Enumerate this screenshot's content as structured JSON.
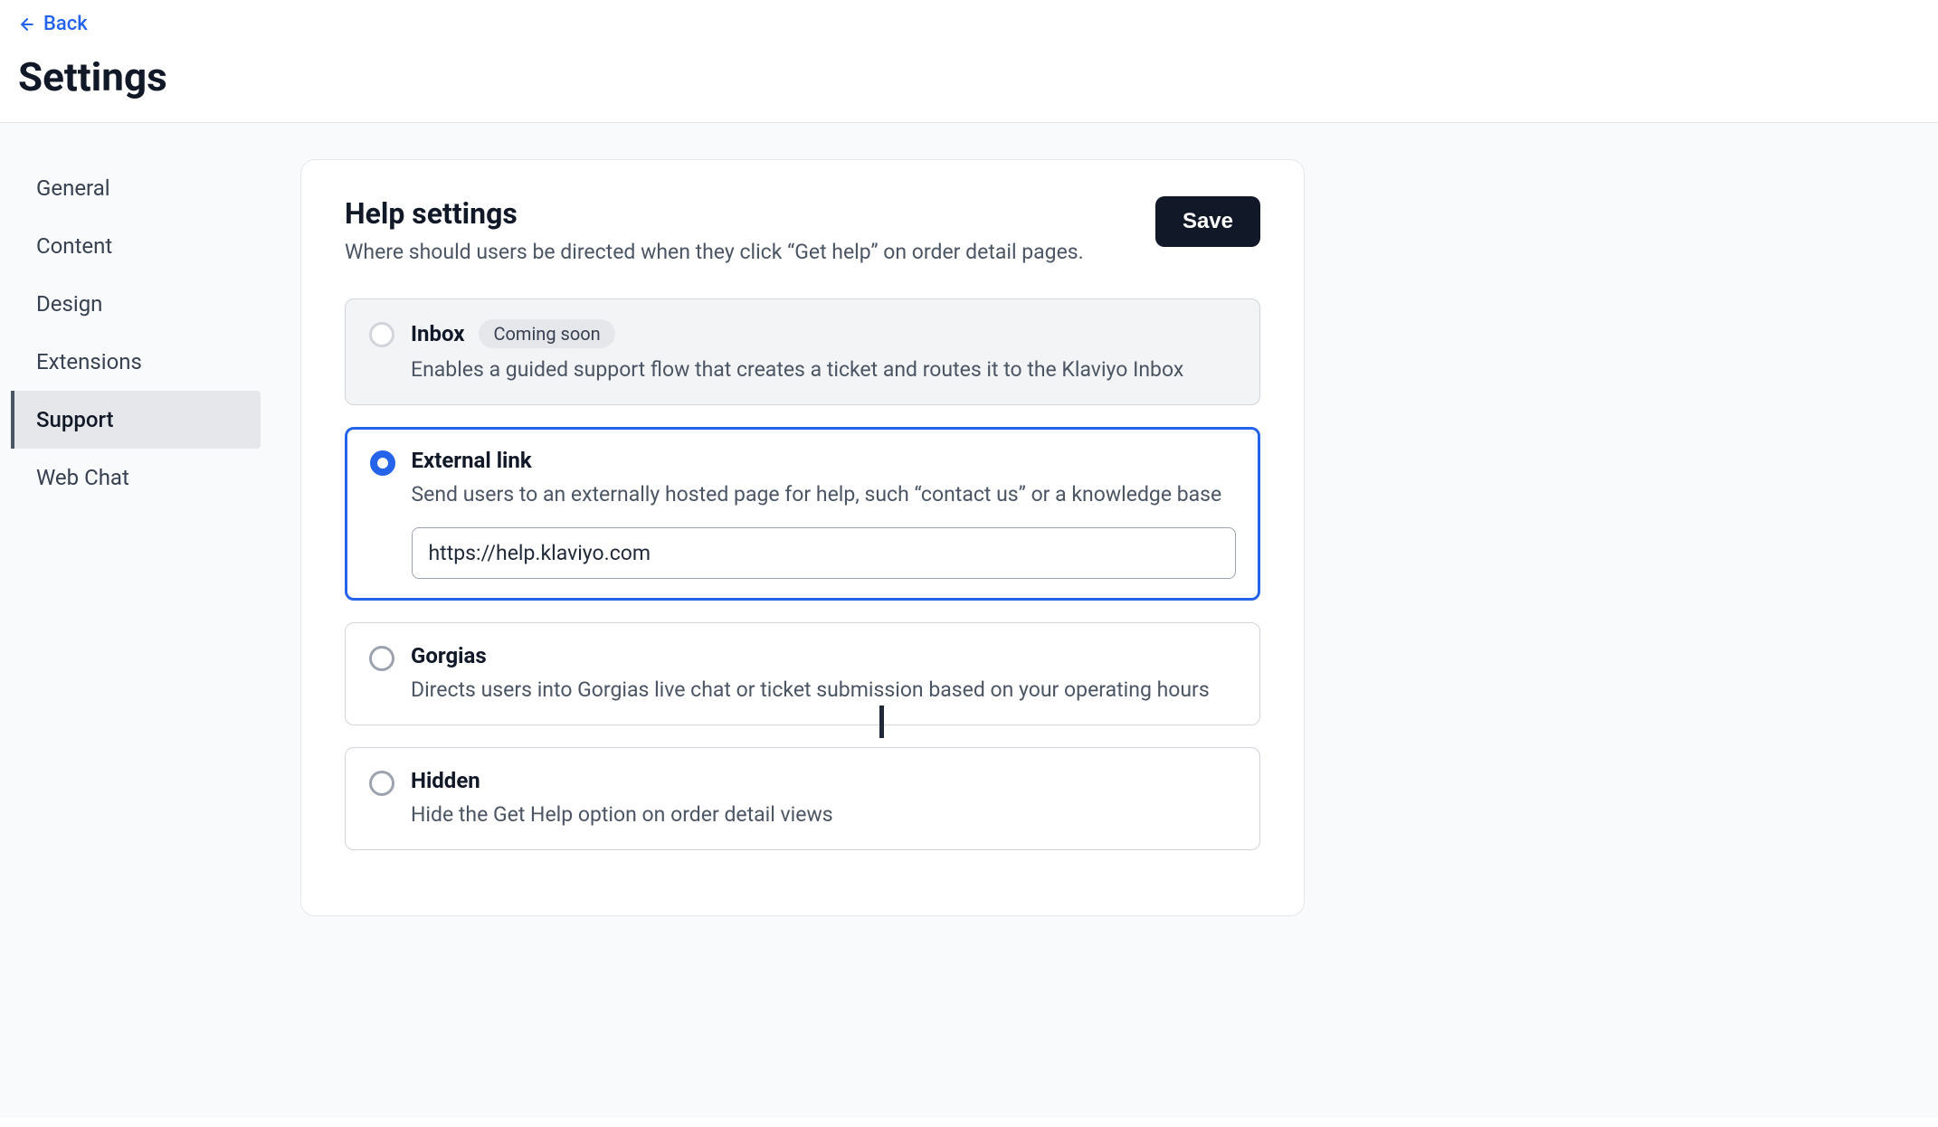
{
  "header": {
    "back_label": "Back",
    "title": "Settings"
  },
  "sidebar": {
    "items": [
      {
        "label": "General",
        "active": false
      },
      {
        "label": "Content",
        "active": false
      },
      {
        "label": "Design",
        "active": false
      },
      {
        "label": "Extensions",
        "active": false
      },
      {
        "label": "Support",
        "active": true
      },
      {
        "label": "Web Chat",
        "active": false
      }
    ]
  },
  "panel": {
    "title": "Help settings",
    "subtitle": "Where should users be directed when they click “Get help” on order detail pages.",
    "save_label": "Save"
  },
  "options": {
    "inbox": {
      "title": "Inbox",
      "badge": "Coming soon",
      "desc": "Enables a guided support flow that creates a ticket and routes it to the Klaviyo Inbox"
    },
    "external": {
      "title": "External link",
      "desc": "Send users to an externally hosted page for help, such “contact us” or a knowledge base",
      "url_value": "https://help.klaviyo.com"
    },
    "gorgias": {
      "title": "Gorgias",
      "desc": "Directs users into Gorgias live chat or ticket submission based on your operating hours"
    },
    "hidden": {
      "title": "Hidden",
      "desc": "Hide the Get Help option on order detail views"
    }
  }
}
